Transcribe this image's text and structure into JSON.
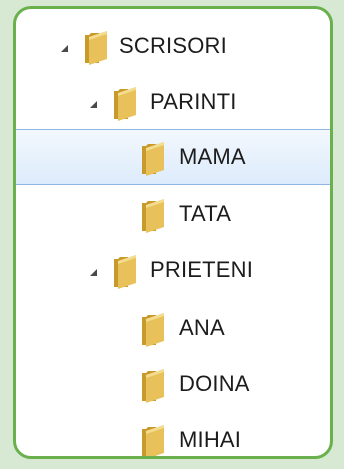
{
  "tree": {
    "nodes": [
      {
        "label": "SCRISORI",
        "expanded": true,
        "has_children": true,
        "selected": false,
        "icon": "folder-icon"
      },
      {
        "label": "PARINTI",
        "expanded": true,
        "has_children": true,
        "selected": false,
        "icon": "folder-icon"
      },
      {
        "label": "MAMA",
        "expanded": false,
        "has_children": false,
        "selected": true,
        "icon": "folder-icon"
      },
      {
        "label": "TATA",
        "expanded": false,
        "has_children": false,
        "selected": false,
        "icon": "folder-icon"
      },
      {
        "label": "PRIETENI",
        "expanded": true,
        "has_children": true,
        "selected": false,
        "icon": "folder-icon"
      },
      {
        "label": "ANA",
        "expanded": false,
        "has_children": false,
        "selected": false,
        "icon": "folder-icon"
      },
      {
        "label": "DOINA",
        "expanded": false,
        "has_children": false,
        "selected": false,
        "icon": "folder-icon"
      },
      {
        "label": "MIHAI",
        "expanded": false,
        "has_children": false,
        "selected": false,
        "icon": "folder-icon"
      }
    ]
  },
  "colors": {
    "background": "#d7e8d3",
    "panel_border": "#6ab04c",
    "selection_fill": "#dcebfc",
    "selection_border": "#8fb6e3",
    "folder_main": "#e8c15a",
    "folder_dark": "#c79a2b"
  }
}
